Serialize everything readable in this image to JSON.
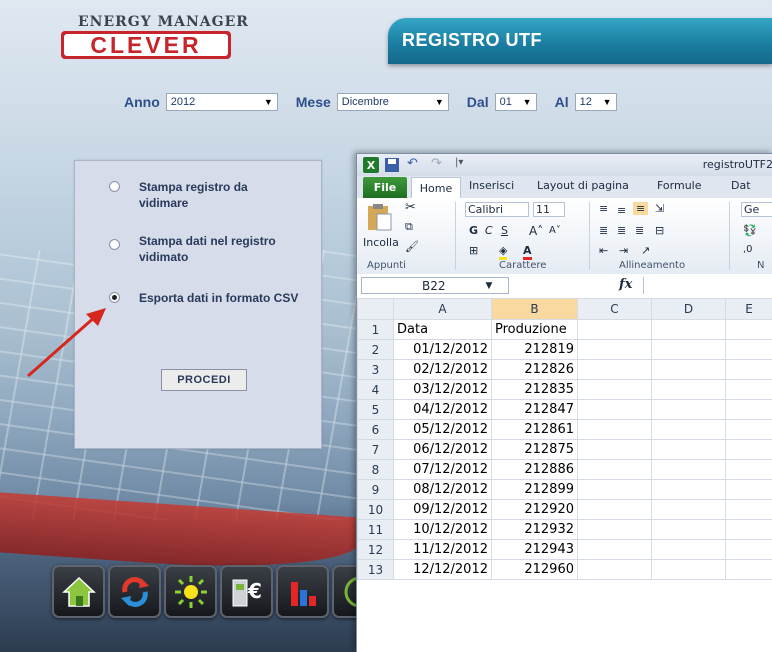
{
  "brand": {
    "top": "ENERGY MANAGER",
    "logo": "CLEVER"
  },
  "title": "REGISTRO UTF",
  "filters": {
    "anno_label": "Anno",
    "anno_value": "2012",
    "mese_label": "Mese",
    "mese_value": "Dicembre",
    "dal_label": "Dal",
    "dal_value": "01",
    "al_label": "Al",
    "al_value": "12"
  },
  "options": [
    {
      "label": "Stampa registro da vidimare",
      "selected": false
    },
    {
      "label": "Stampa dati nel registro vidimato",
      "selected": false
    },
    {
      "label": "Esporta dati in formato CSV",
      "selected": true
    }
  ],
  "procedi_label": "PROCEDI",
  "toolbar_icons": [
    "home-icon",
    "refresh-icon",
    "sun-icon",
    "euro-meter-icon",
    "bar-chart-icon"
  ],
  "excel": {
    "window_title": "registroUTF2",
    "tabs": {
      "file": "File",
      "home": "Home",
      "inserisci": "Inserisci",
      "layout": "Layout di pagina",
      "formule": "Formule",
      "dati": "Dat"
    },
    "ribbon": {
      "incolla": "Incolla",
      "font_name": "Calibri",
      "font_size": "11",
      "bold": "G",
      "italic": "C",
      "underline": "S",
      "general_partial": "Ge",
      "groups": {
        "appunti": "Appunti",
        "carattere": "Carattere",
        "allineamento": "Allineamento",
        "partial": "N"
      }
    },
    "name_box": "B22",
    "fx": "fx",
    "columns": [
      "A",
      "B",
      "C",
      "D",
      "E"
    ],
    "rows": [
      {
        "n": "1",
        "a": "Data",
        "b": "Produzione"
      },
      {
        "n": "2",
        "a": "01/12/2012",
        "b": "212819"
      },
      {
        "n": "3",
        "a": "02/12/2012",
        "b": "212826"
      },
      {
        "n": "4",
        "a": "03/12/2012",
        "b": "212835"
      },
      {
        "n": "5",
        "a": "04/12/2012",
        "b": "212847"
      },
      {
        "n": "6",
        "a": "05/12/2012",
        "b": "212861"
      },
      {
        "n": "7",
        "a": "06/12/2012",
        "b": "212875"
      },
      {
        "n": "8",
        "a": "07/12/2012",
        "b": "212886"
      },
      {
        "n": "9",
        "a": "08/12/2012",
        "b": "212899"
      },
      {
        "n": "10",
        "a": "09/12/2012",
        "b": "212920"
      },
      {
        "n": "11",
        "a": "10/12/2012",
        "b": "212932"
      },
      {
        "n": "12",
        "a": "11/12/2012",
        "b": "212943"
      },
      {
        "n": "13",
        "a": "12/12/2012",
        "b": "212960"
      }
    ]
  },
  "colors": {
    "title_bar": "#1b7fa3",
    "label_blue": "#2f4e8c",
    "panel": "#d6dce9",
    "excel_green": "#1f6e21",
    "arrow_red": "#d7261e"
  }
}
